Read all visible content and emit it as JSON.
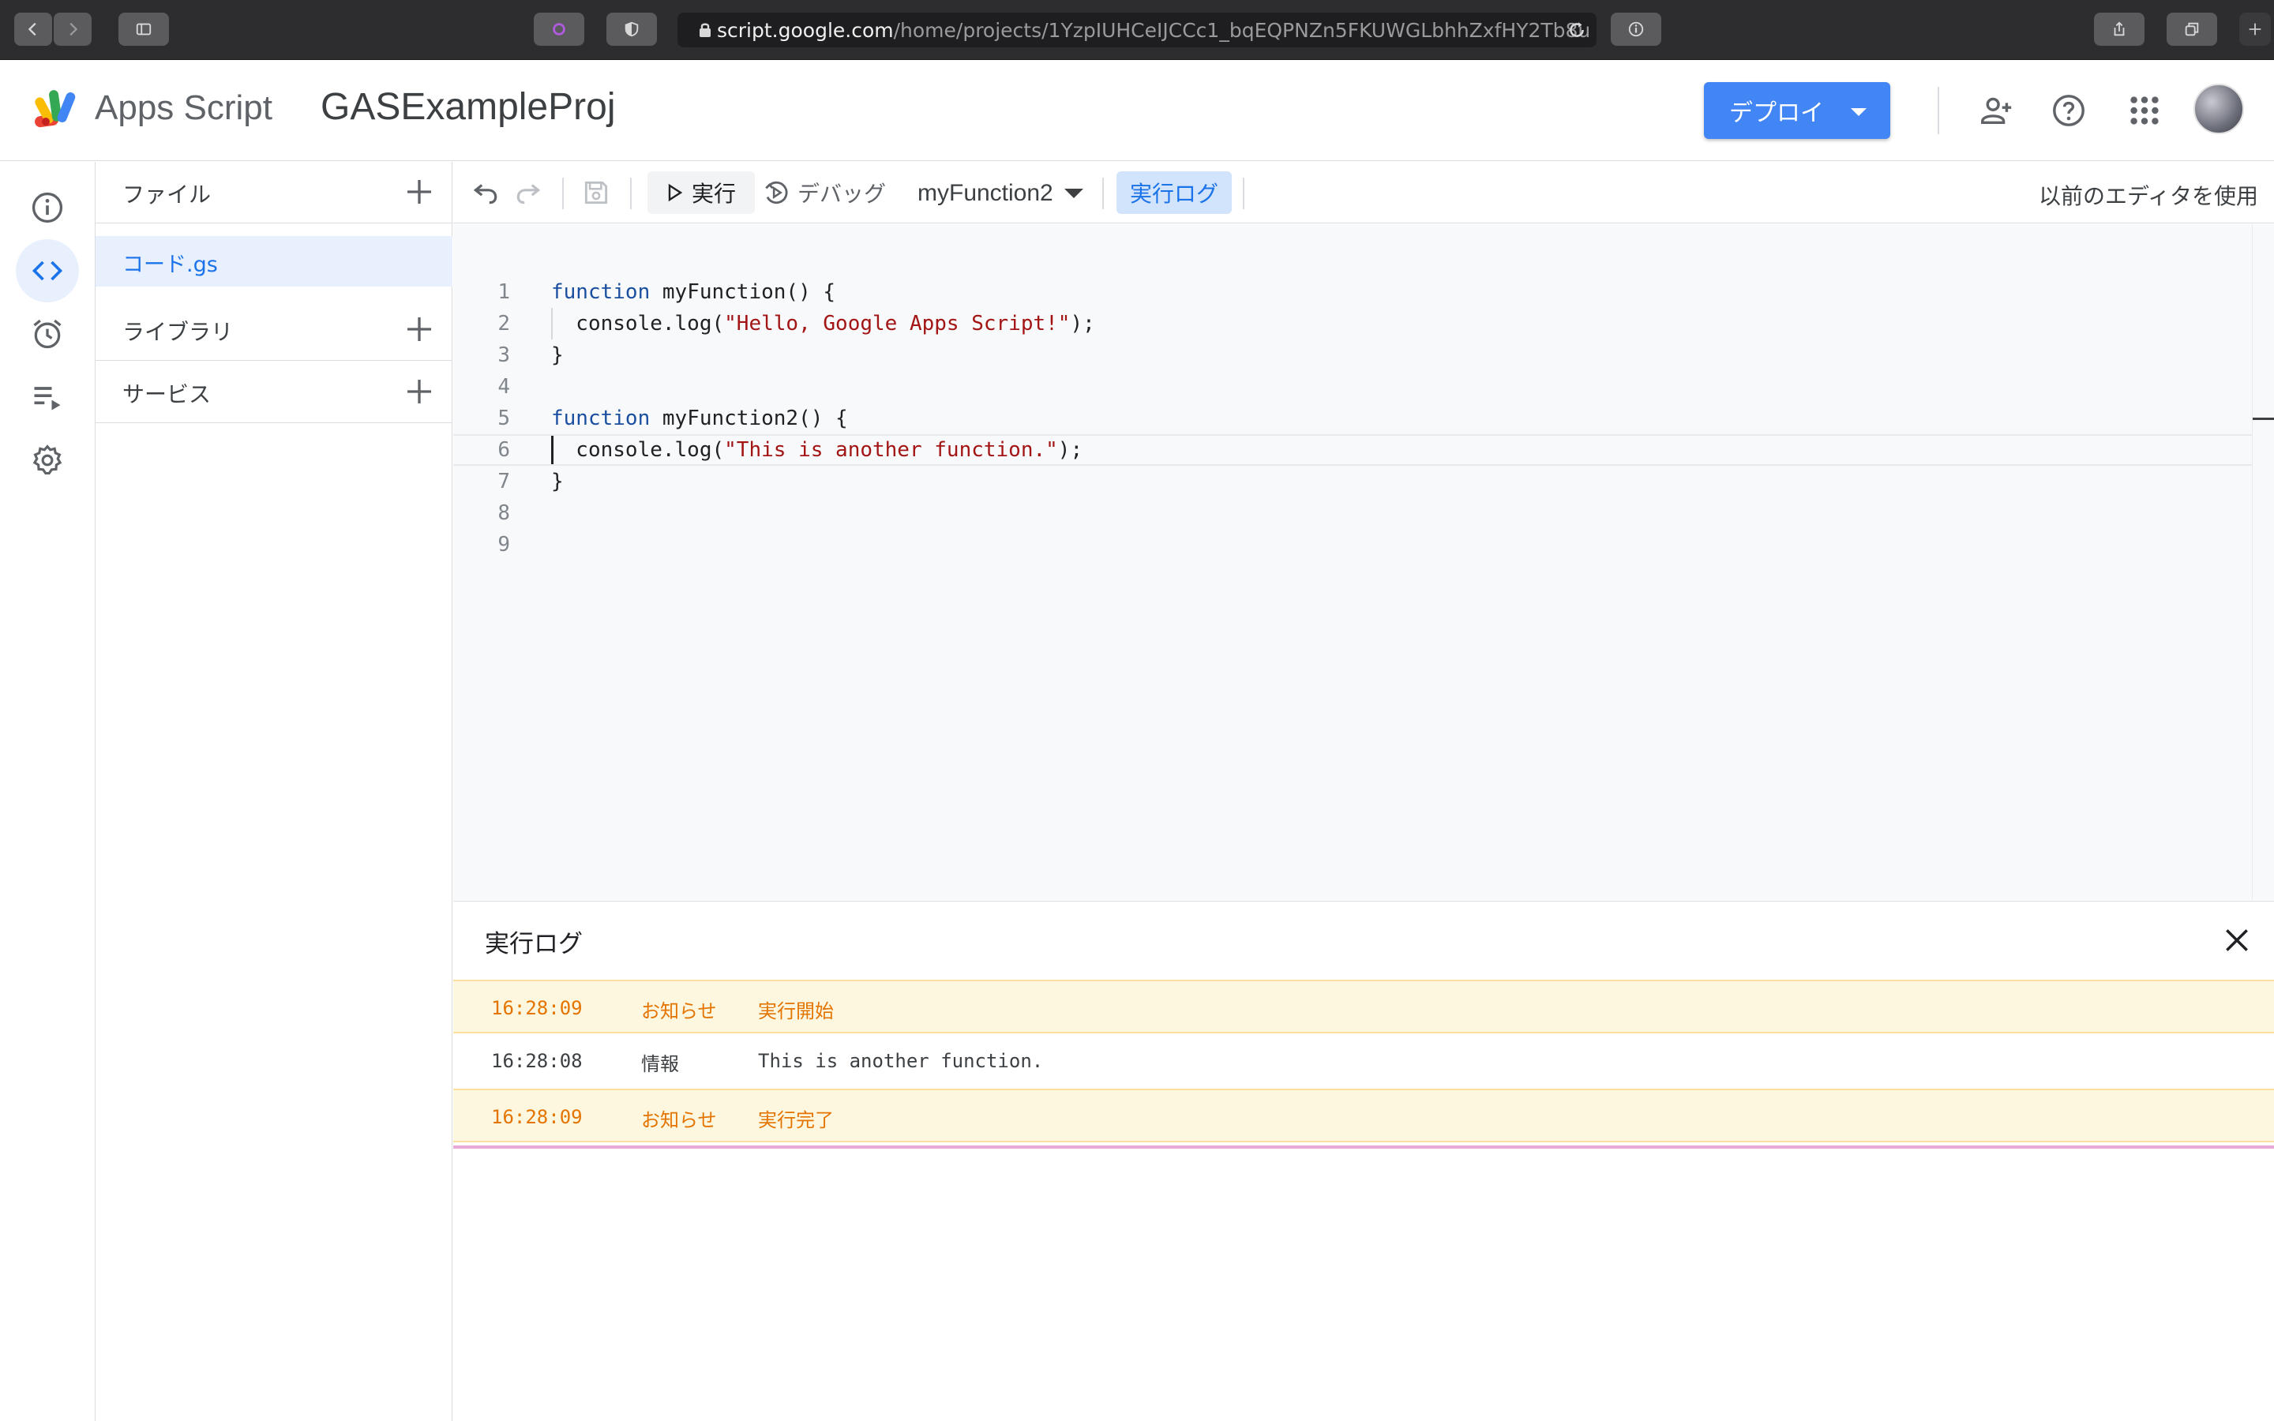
{
  "browser": {
    "url_host": "script.google.com",
    "url_path": "/home/projects/1YzpIUHCeIJCCc1_bqEQPNZn5FKUWGLbhhZxfHY2Tb8u"
  },
  "header": {
    "product_name": "Apps Script",
    "project_name": "GASExampleProj",
    "deploy_label": "デプロイ"
  },
  "rail": {
    "items": [
      "info-icon",
      "code-icon",
      "clock-icon",
      "executions-icon",
      "settings-icon"
    ],
    "active": "code-icon"
  },
  "files": {
    "title": "ファイル",
    "items": [
      {
        "label": "コード.gs"
      }
    ],
    "libraries_title": "ライブラリ",
    "services_title": "サービス"
  },
  "toolbar": {
    "run_label": "実行",
    "debug_label": "デバッグ",
    "selected_function": "myFunction2",
    "log_label": "実行ログ",
    "legacy_label": "以前のエディタを使用"
  },
  "editor": {
    "lines": [
      {
        "n": "1",
        "parts": [
          [
            "kw",
            "function"
          ],
          [
            "p",
            " myFunction() {"
          ]
        ]
      },
      {
        "n": "2",
        "parts": [
          [
            "p",
            "  console.log("
          ],
          [
            "str",
            "\"Hello, Google Apps Script!\""
          ],
          [
            "p",
            ");"
          ]
        ]
      },
      {
        "n": "3",
        "parts": [
          [
            "p",
            "}"
          ]
        ]
      },
      {
        "n": "4",
        "parts": []
      },
      {
        "n": "5",
        "parts": [
          [
            "kw",
            "function"
          ],
          [
            "p",
            " myFunction2() {"
          ]
        ]
      },
      {
        "n": "6",
        "parts": [
          [
            "p",
            "  console.log("
          ],
          [
            "str",
            "\"This is another function.\""
          ],
          [
            "p",
            ");"
          ]
        ]
      },
      {
        "n": "7",
        "parts": [
          [
            "p",
            "}"
          ]
        ]
      },
      {
        "n": "8",
        "parts": []
      },
      {
        "n": "9",
        "parts": []
      }
    ],
    "current_line": "6"
  },
  "log": {
    "title": "実行ログ",
    "rows": [
      {
        "time": "16:28:09",
        "level": "お知らせ",
        "message": "実行開始",
        "kind": "notice"
      },
      {
        "time": "16:28:08",
        "level": "情報",
        "message": "This is another function.",
        "kind": "info"
      },
      {
        "time": "16:28:09",
        "level": "お知らせ",
        "message": "実行完了",
        "kind": "notice"
      }
    ]
  },
  "colors": {
    "accent": "#4285f4",
    "notice": "#e37400",
    "notice_bg": "#fef7e0"
  }
}
